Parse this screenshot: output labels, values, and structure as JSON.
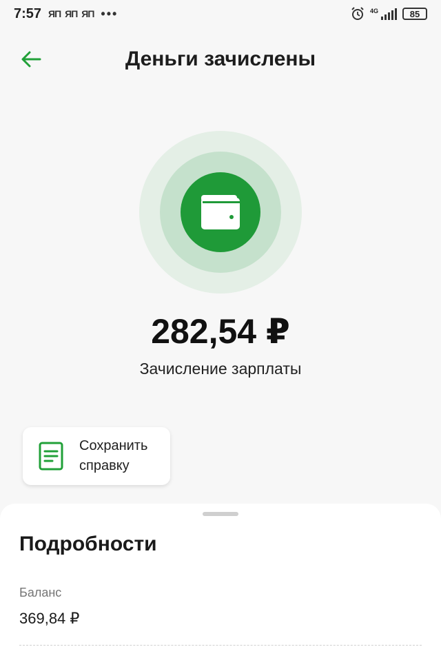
{
  "status_bar": {
    "time": "7:57",
    "notifications": [
      "ЯП",
      "ЯП",
      "ЯП"
    ],
    "more": "•••",
    "network": "4G",
    "battery": "85"
  },
  "header": {
    "title": "Деньги зачислены",
    "back_icon": "arrow-left-icon"
  },
  "hero": {
    "icon": "wallet-icon",
    "amount": "282,54 ₽",
    "description": "Зачисление зарплаты",
    "accent_color": "#1f9a38"
  },
  "actions": {
    "save_line1": "Сохранить",
    "save_line2": "справку",
    "save_icon": "document-icon"
  },
  "details": {
    "title": "Подробности",
    "balance_label": "Баланс",
    "balance_value": "369,84 ₽"
  }
}
